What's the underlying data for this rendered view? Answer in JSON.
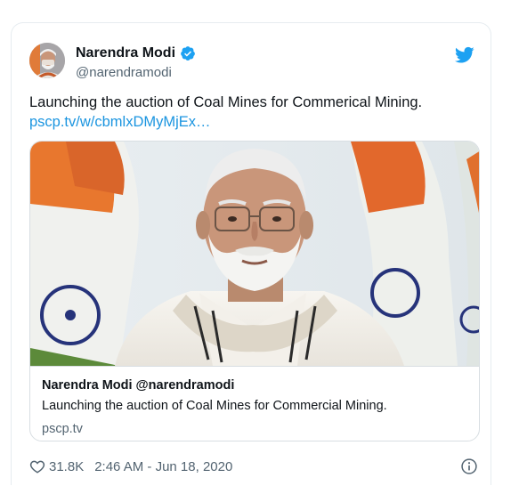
{
  "author": {
    "display_name": "Narendra Modi",
    "handle": "@narendramodi"
  },
  "tweet": {
    "text": "Launching the auction of Coal Mines for Commerical Mining.",
    "link": "pscp.tv/w/cbmlxDMyMjEx…"
  },
  "card": {
    "title": "Narendra Modi @narendramodi",
    "description": "Launching the auction of Coal Mines for Commercial Mining.",
    "domain": "pscp.tv"
  },
  "footer": {
    "likes": "31.8K",
    "timestamp": "2:46 AM - Jun 18, 2020"
  },
  "colors": {
    "link": "#1b95e0",
    "twitter_blue": "#1da1f2",
    "muted": "#536471",
    "border": "#e6ecf0"
  },
  "icons": {
    "verified": "verified-badge-icon",
    "brand": "twitter-bird-icon",
    "like": "heart-icon",
    "info": "info-icon"
  }
}
